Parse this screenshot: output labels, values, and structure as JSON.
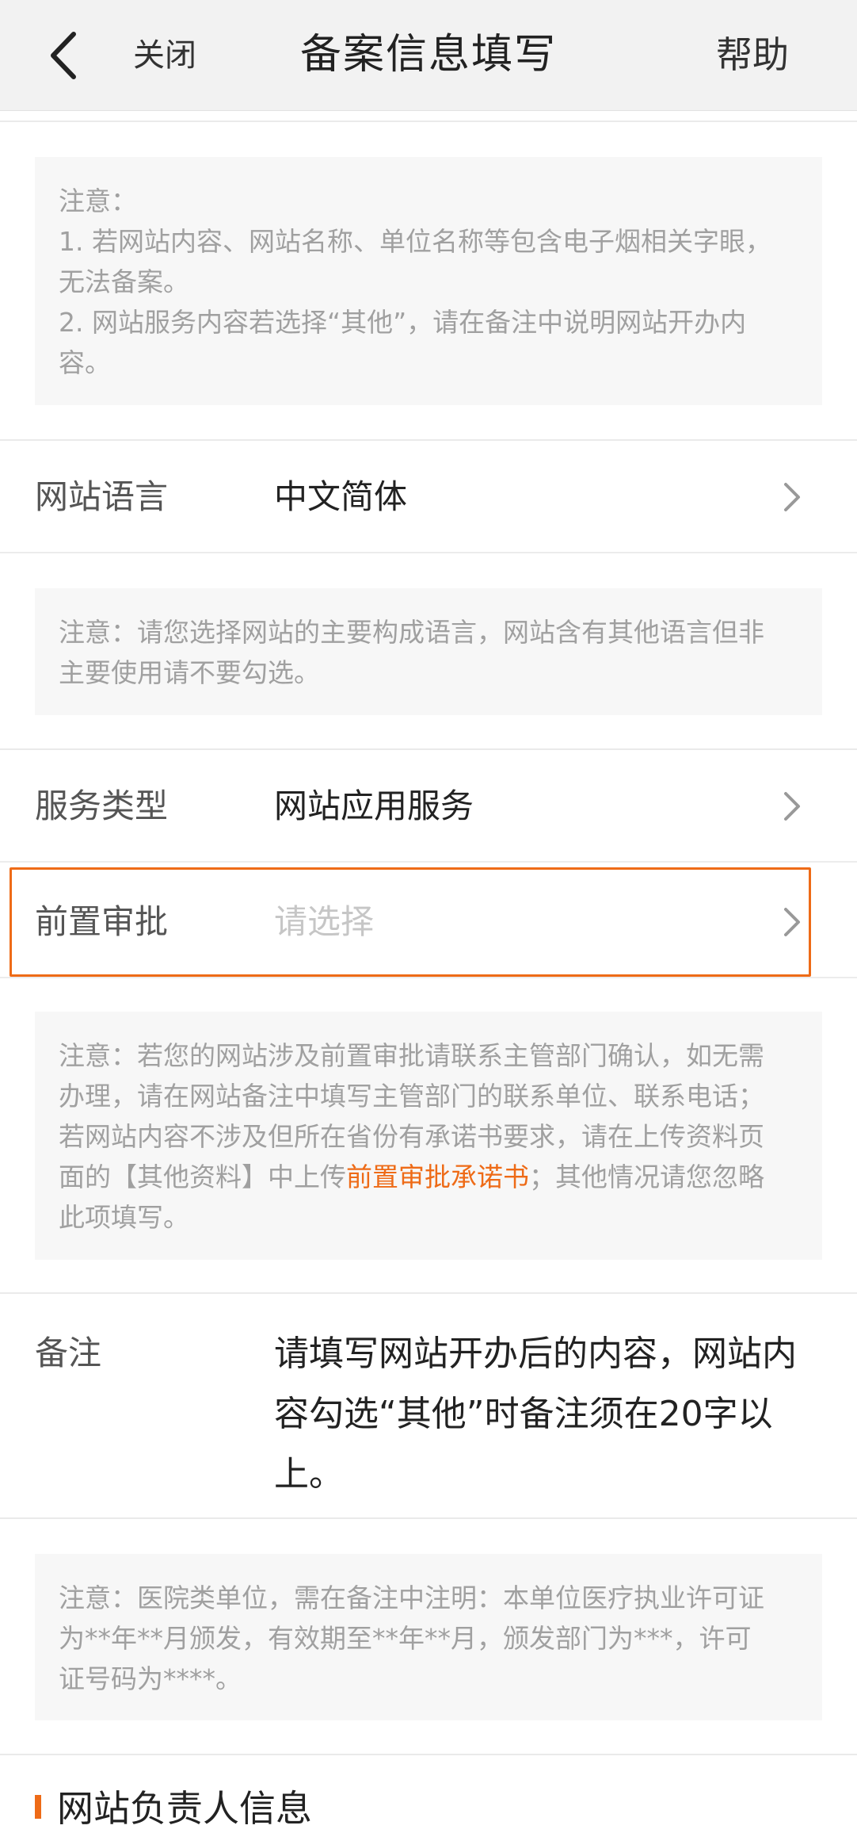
{
  "header": {
    "close_label": "关闭",
    "title": "备案信息填写",
    "help_label": "帮助"
  },
  "notice_top": {
    "lines": [
      "注意：",
      "1. 若网站内容、网站名称、单位名称等包含电子烟相关字眼，",
      "无法备案。",
      "2. 网站服务内容若选择“其他”，请在备注中说明网站开办内",
      "容。"
    ]
  },
  "language": {
    "label": "网站语言",
    "value": "中文简体"
  },
  "notice_language": {
    "lines": [
      "注意：请您选择网站的主要构成语言，网站含有其他语言但非",
      "主要使用请不要勾选。"
    ]
  },
  "service_type": {
    "label": "服务类型",
    "value": "网站应用服务"
  },
  "pre_approval": {
    "label": "前置审批",
    "placeholder": "请选择"
  },
  "notice_approval": {
    "line1": "注意：若您的网站涉及前置审批请联系主管部门确认，如无需",
    "line2": "办理，请在网站备注中填写主管部门的联系单位、联系电话；",
    "line3": "若网站内容不涉及但所在省份有承诺书要求，请在上传资料页",
    "line4_prefix": "面的【其他资料】中上传",
    "line4_link": "前置审批承诺书",
    "line4_suffix": "；其他情况请您忽略",
    "line5": "此项填写。"
  },
  "remark": {
    "label": "备注",
    "lines": [
      "请填写网站开办后的内容，网站内",
      "容勾选“其他”时备注须在20字以",
      "上。"
    ]
  },
  "notice_remark": {
    "lines": [
      "注意：医院类单位，需在备注中注明：本单位医疗执业许可证",
      "为**年**月颁发，有效期至**年**月，颁发部门为***，许可",
      "证号码为****。"
    ]
  },
  "section": {
    "title": "网站负责人信息"
  },
  "colors": {
    "accent": "#ee6b17",
    "note_text": "#a0a0a0",
    "note_bg": "#f7f7f7",
    "header_bg": "#f2f2f2"
  },
  "icons": {
    "back": "chevron-left-icon",
    "row_arrow": "chevron-right-icon"
  }
}
